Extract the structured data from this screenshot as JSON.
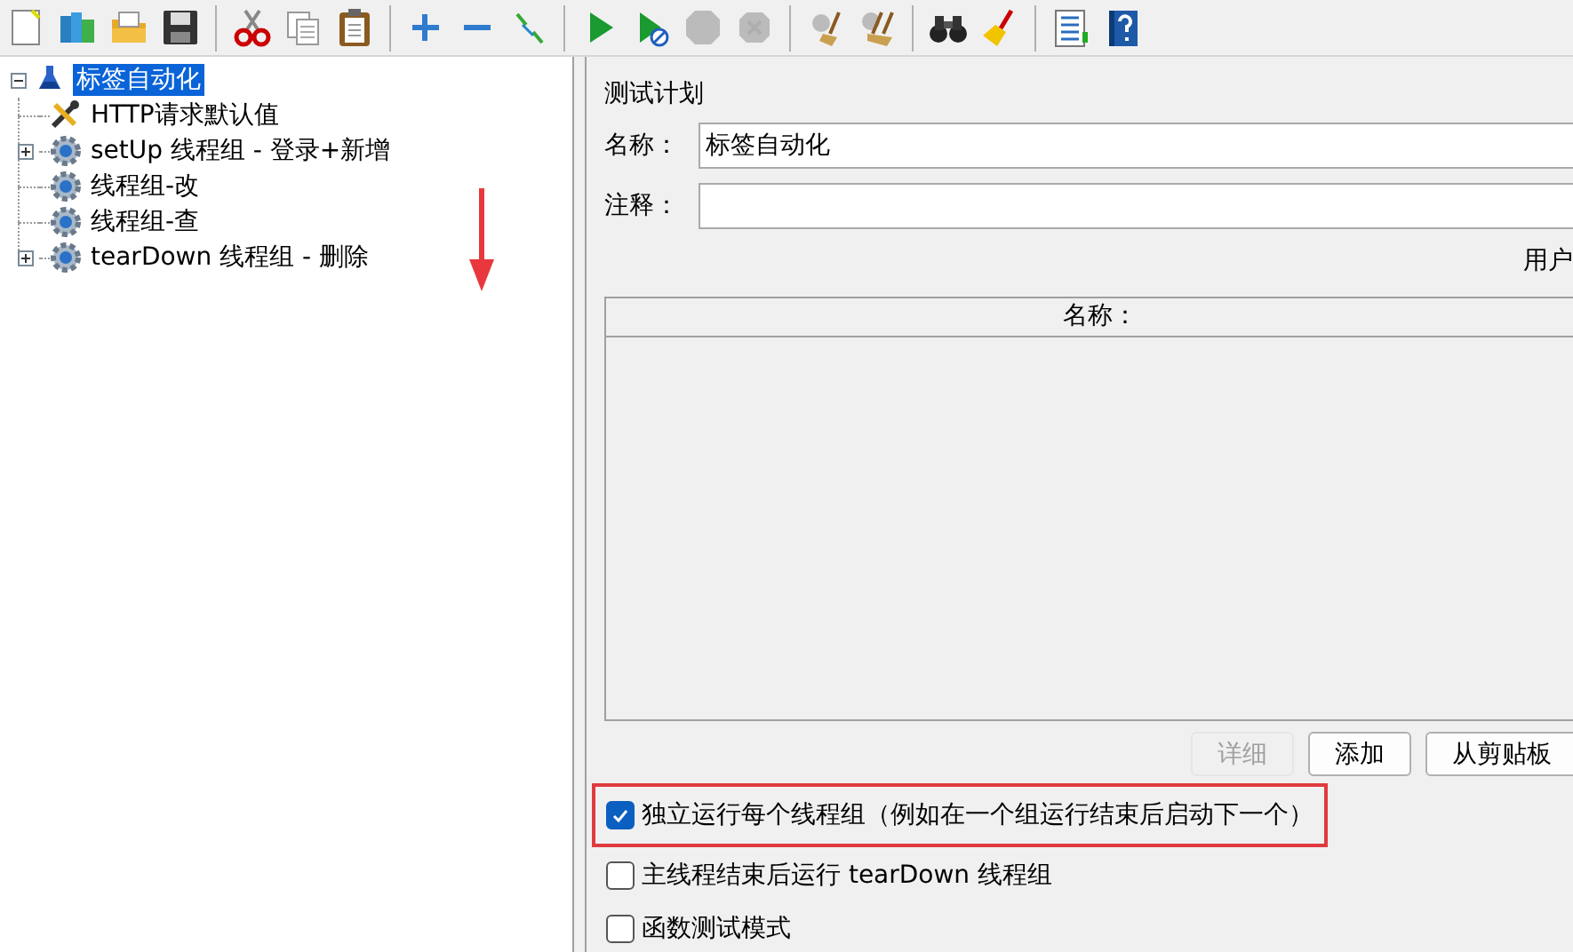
{
  "toolbar": [
    [
      {
        "kind": "new",
        "disabled": false
      },
      {
        "kind": "templates",
        "disabled": false
      },
      {
        "kind": "open",
        "disabled": false
      },
      {
        "kind": "save",
        "disabled": false
      }
    ],
    [
      {
        "kind": "cut",
        "disabled": false
      },
      {
        "kind": "copy",
        "disabled": false
      },
      {
        "kind": "paste",
        "disabled": false
      }
    ],
    [
      {
        "kind": "expand",
        "disabled": false
      },
      {
        "kind": "collapse",
        "disabled": false
      },
      {
        "kind": "toggle",
        "disabled": false
      }
    ],
    [
      {
        "kind": "start",
        "disabled": false
      },
      {
        "kind": "start-no-pause",
        "disabled": false
      },
      {
        "kind": "stop",
        "disabled": true
      },
      {
        "kind": "shutdown",
        "disabled": true
      }
    ],
    [
      {
        "kind": "clear",
        "disabled": false
      },
      {
        "kind": "clear-all",
        "disabled": false
      }
    ],
    [
      {
        "kind": "search",
        "disabled": false
      },
      {
        "kind": "reset-search",
        "disabled": false
      }
    ],
    [
      {
        "kind": "functions",
        "disabled": false
      },
      {
        "kind": "help",
        "disabled": false
      }
    ]
  ],
  "tree": {
    "label": "标签自动化",
    "kind": "plan",
    "expanded": true,
    "selected": true,
    "children": [
      {
        "label": "HTTP请求默认值",
        "kind": "config",
        "selected": false
      },
      {
        "label": "setUp 线程组 - 登录+新增",
        "kind": "thread-group",
        "expanded": false,
        "selected": false
      },
      {
        "label": "线程组-改",
        "kind": "thread-group",
        "selected": false
      },
      {
        "label": "线程组-查",
        "kind": "thread-group",
        "selected": false
      },
      {
        "label": "tearDown 线程组 - 删除",
        "kind": "thread-group",
        "expanded": false,
        "selected": false
      }
    ]
  },
  "annotations": [
    {
      "kind": "down-arrow"
    }
  ],
  "panel": {
    "title": "测试计划",
    "fields": [
      {
        "label": "名称：",
        "value": "标签自动化"
      },
      {
        "label": "注释："
      }
    ],
    "variables_label": "用户",
    "table": {
      "columns": [
        "名称："
      ]
    },
    "buttons": [
      {
        "label": "详细",
        "disabled": true
      },
      {
        "label": "添加",
        "disabled": false
      },
      {
        "label": "从剪贴板",
        "disabled": false
      }
    ],
    "options": [
      {
        "label": "独立运行每个线程组（例如在一个组运行结束后启动下一个）",
        "checked": true,
        "highlighted": true
      },
      {
        "label": "主线程结束后运行 tearDown 线程组",
        "checked": false,
        "highlighted": false
      },
      {
        "label": "函数测试模式",
        "checked": false,
        "highlighted": false
      }
    ]
  }
}
